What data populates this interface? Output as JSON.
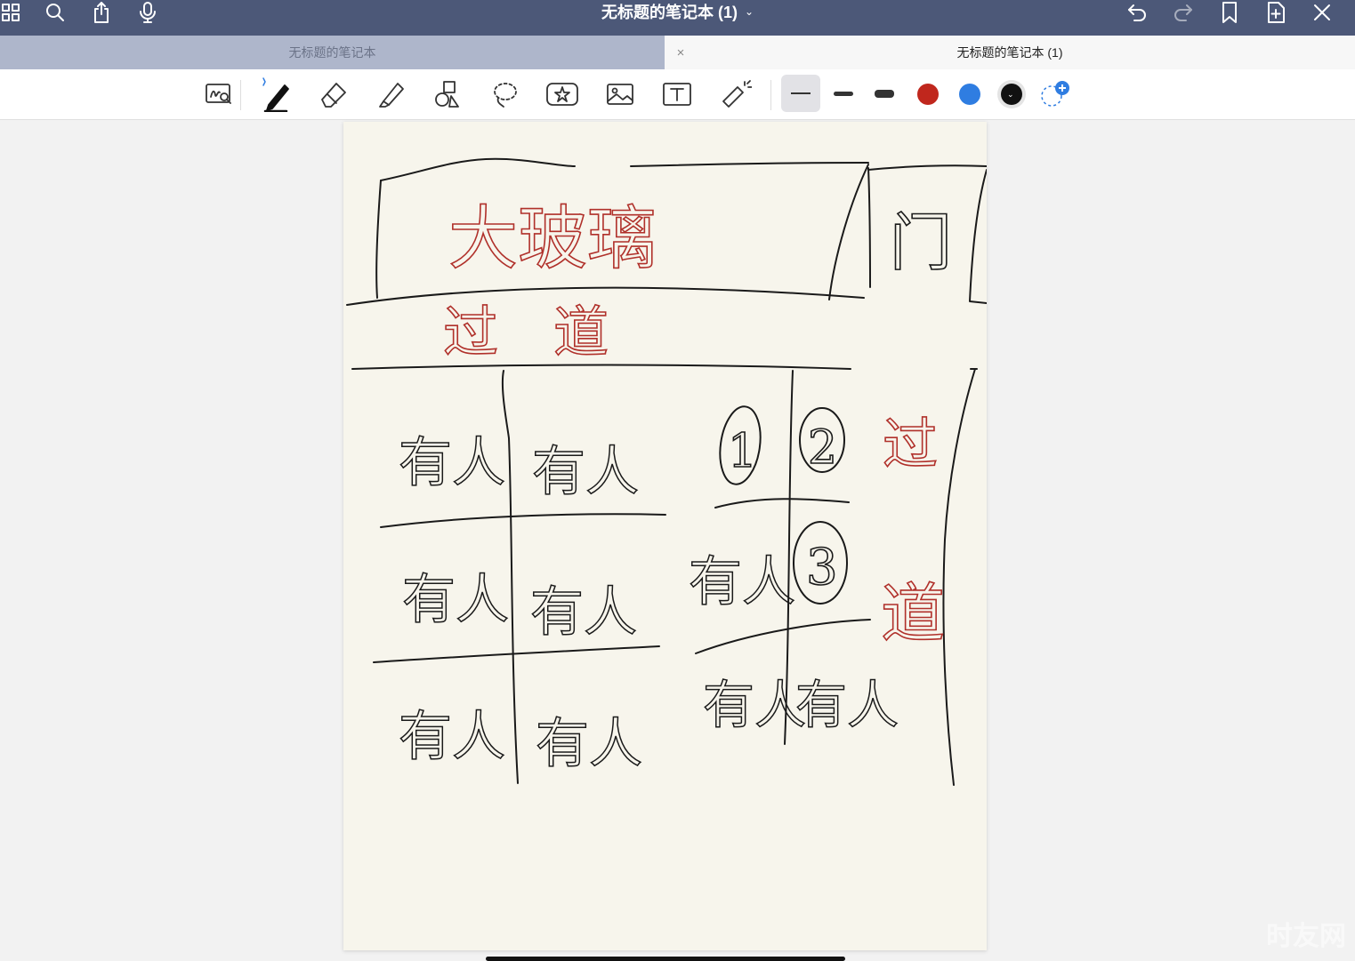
{
  "app": {
    "title": "无标题的笔记本 (1)",
    "title_chevron": "⌄"
  },
  "tabs": [
    {
      "label": "无标题的笔记本",
      "active": false
    },
    {
      "label": "无标题的笔记本 (1)",
      "active": true
    }
  ],
  "tab_close_glyph": "×",
  "top_icons": [
    "grid-icon",
    "search-icon",
    "share-icon",
    "microphone-icon",
    "undo-icon",
    "redo-icon",
    "bookmark-icon",
    "add-page-icon",
    "close-icon"
  ],
  "toolbar": {
    "tools": [
      "zoom-window",
      "pen",
      "eraser",
      "highlighter",
      "shapes",
      "lasso",
      "sticker",
      "image",
      "text",
      "laser-pointer"
    ],
    "active_tool": "pen",
    "stroke_widths": [
      "thin",
      "medium",
      "thick"
    ],
    "selected_width": "thin",
    "colors": [
      "#c0271d",
      "#2f7de1",
      "#111111"
    ],
    "selected_color": "#111111"
  },
  "note": {
    "red_texts": {
      "title": "大玻璃",
      "aisle_h": "过　道",
      "aisle_v_top": "过",
      "aisle_v_bottom": "道"
    },
    "black_texts": {
      "door": "门",
      "seat": "有人",
      "n1": "1",
      "n2": "2",
      "n3": "3"
    }
  },
  "watermark": "时友网"
}
